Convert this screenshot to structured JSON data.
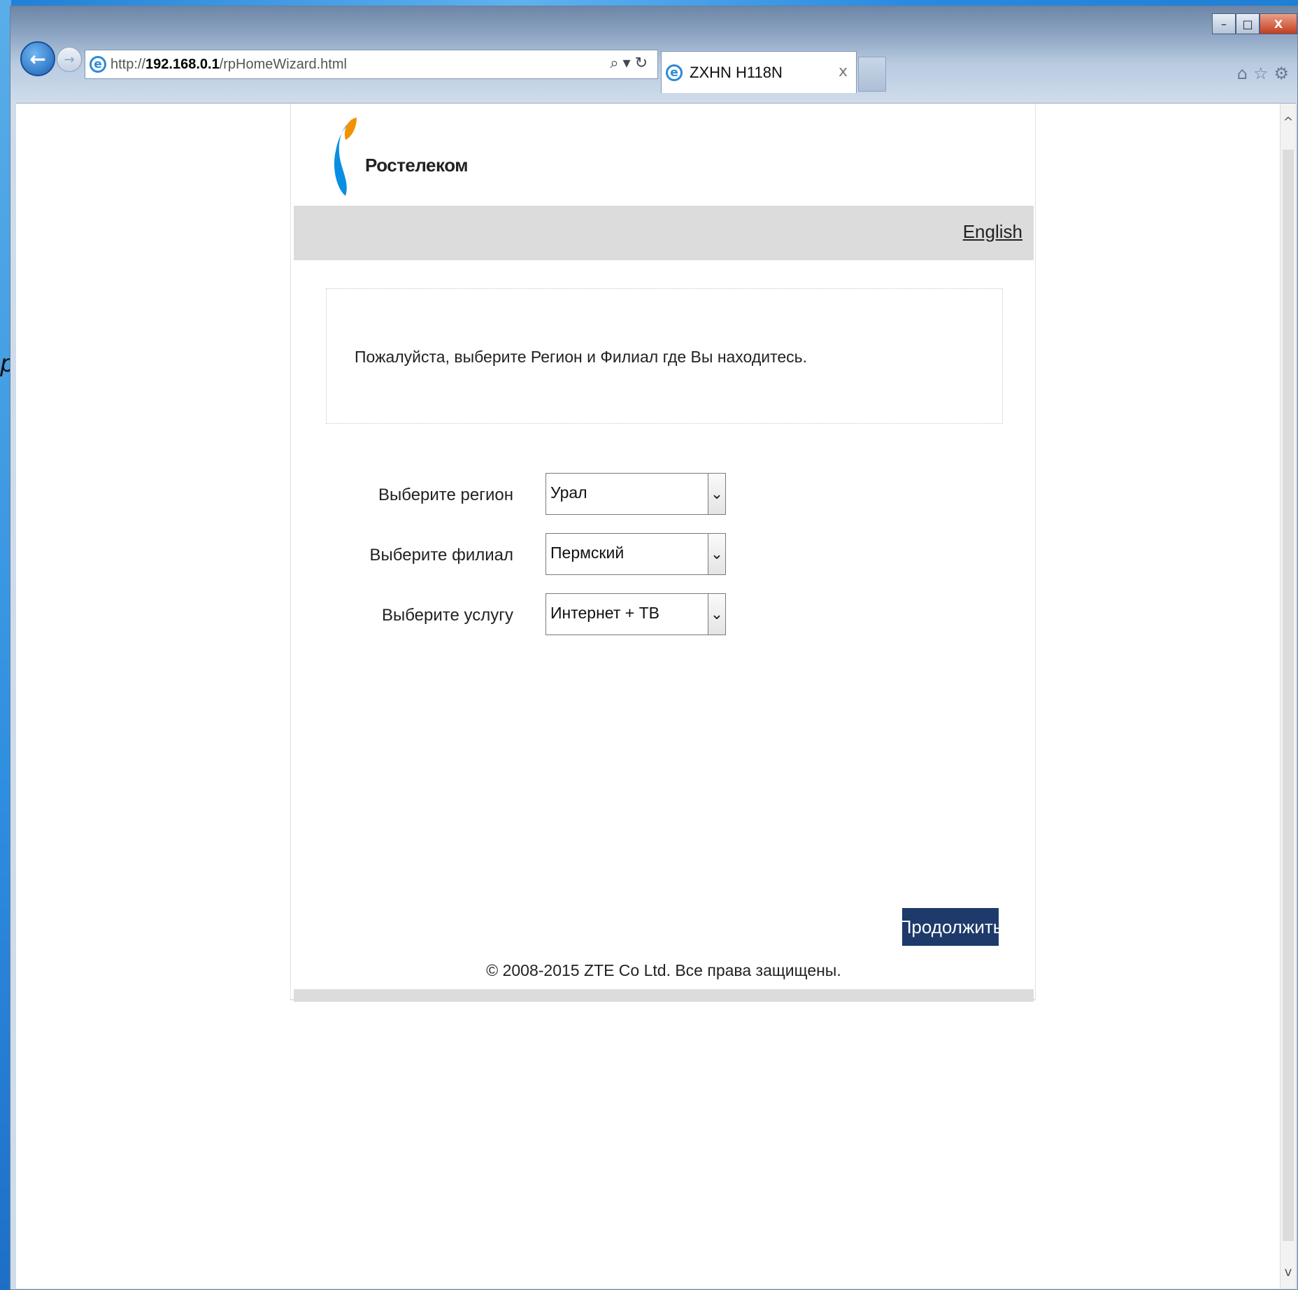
{
  "browser": {
    "url_proto": "http://",
    "url_host": "192.168.0.1",
    "url_path": "/rpHomeWizard.html",
    "addr_tools": "⌕▾↻",
    "tab_title": "ZXHN H118N",
    "tab_close": "x",
    "caption": {
      "minimize": "–",
      "maximize": "□",
      "close": "X"
    },
    "right_tools": "⌂☆⚙"
  },
  "page": {
    "logo_text": "Ростелеком",
    "language_link": "English",
    "notice": "Пожалуйста, выберите Регион и Филиал где Вы находитесь.",
    "form": {
      "region_label": "Выберите регион",
      "region_value": "Урал",
      "branch_label": "Выберите филиал",
      "branch_value": "Пермский",
      "service_label": "Выберите услугу",
      "service_value": "Интернет + ТВ"
    },
    "continue_label": "Продолжить",
    "copyright": "© 2008-2015 ZTE Co Ltd. Все права защищены."
  },
  "colors": {
    "brand_blue": "#0a8ee3",
    "brand_orange": "#f39200",
    "button_bg": "#1d3a6b",
    "header_bar": "#dcdcdc"
  },
  "icons": {
    "back": "back-arrow-icon",
    "forward": "forward-arrow-icon",
    "ie": "ie-logo-icon",
    "search": "search-icon",
    "refresh": "refresh-icon",
    "home": "home-icon",
    "favorites": "star-icon",
    "settings": "gear-icon",
    "dropdown": "chevron-down-icon"
  }
}
